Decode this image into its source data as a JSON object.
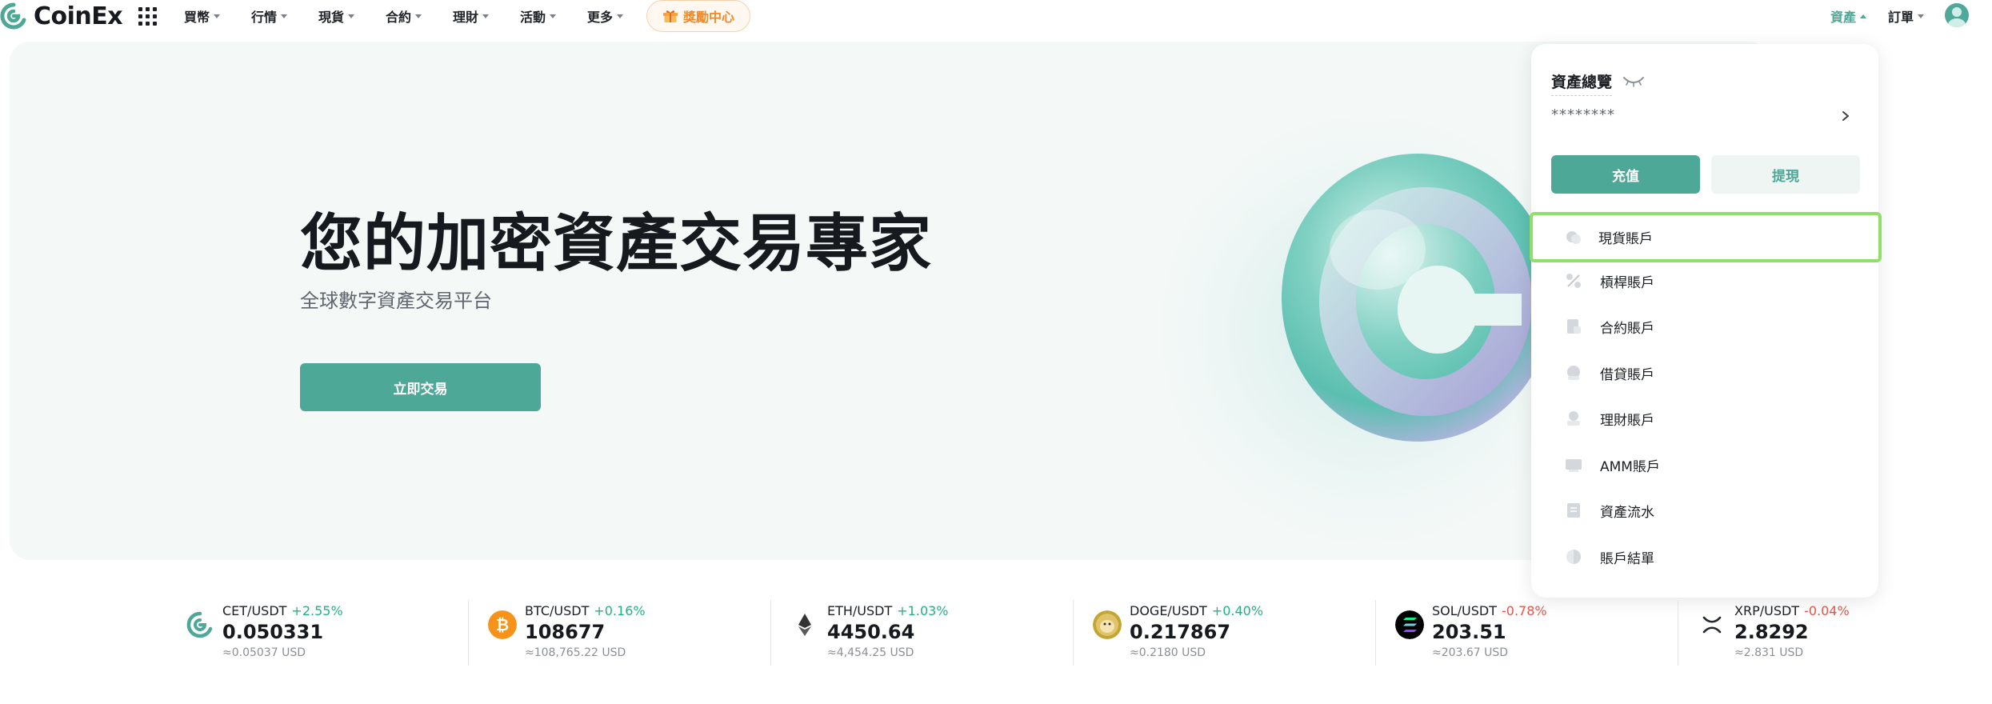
{
  "brand": {
    "name": "CoinEx",
    "accent": "#4ea898"
  },
  "nav": {
    "items": [
      "買幣",
      "行情",
      "現貨",
      "合約",
      "理財",
      "活動",
      "更多"
    ],
    "reward": "獎勵中心",
    "assets": "資產",
    "orders": "訂單"
  },
  "hero": {
    "title": "您的加密資產交易專家",
    "subtitle": "全球數字資產交易平台",
    "button": "立即交易"
  },
  "dropdown": {
    "title": "資產總覽",
    "masked_balance": "********",
    "deposit": "充值",
    "withdraw": "提現",
    "accounts": [
      {
        "label": "現貨賬戶",
        "icon": "spot-account-icon",
        "active": true
      },
      {
        "label": "槓桿賬戶",
        "icon": "margin-account-icon"
      },
      {
        "label": "合約賬戶",
        "icon": "futures-account-icon"
      },
      {
        "label": "借貸賬戶",
        "icon": "loan-account-icon"
      },
      {
        "label": "理財賬戶",
        "icon": "financial-account-icon"
      },
      {
        "label": "AMM賬戶",
        "icon": "amm-account-icon"
      },
      {
        "label": "資產流水",
        "icon": "asset-history-icon"
      },
      {
        "label": "賬戶結單",
        "icon": "account-statement-icon"
      }
    ]
  },
  "tickers": [
    {
      "pair": "CET/USDT",
      "change": "+2.55%",
      "direction": "up",
      "price": "0.050331",
      "usd": "≈0.05037 USD",
      "icon": "cet-coin-icon"
    },
    {
      "pair": "BTC/USDT",
      "change": "+0.16%",
      "direction": "up",
      "price": "108677",
      "usd": "≈108,765.22 USD",
      "icon": "btc-coin-icon"
    },
    {
      "pair": "ETH/USDT",
      "change": "+1.03%",
      "direction": "up",
      "price": "4450.64",
      "usd": "≈4,454.25 USD",
      "icon": "eth-coin-icon"
    },
    {
      "pair": "DOGE/USDT",
      "change": "+0.40%",
      "direction": "up",
      "price": "0.217867",
      "usd": "≈0.2180 USD",
      "icon": "doge-coin-icon"
    },
    {
      "pair": "SOL/USDT",
      "change": "-0.78%",
      "direction": "down",
      "price": "203.51",
      "usd": "≈203.67 USD",
      "icon": "sol-coin-icon"
    },
    {
      "pair": "XRP/USDT",
      "change": "-0.04%",
      "direction": "down",
      "price": "2.8292",
      "usd": "≈2.831 USD",
      "icon": "xrp-coin-icon"
    }
  ]
}
